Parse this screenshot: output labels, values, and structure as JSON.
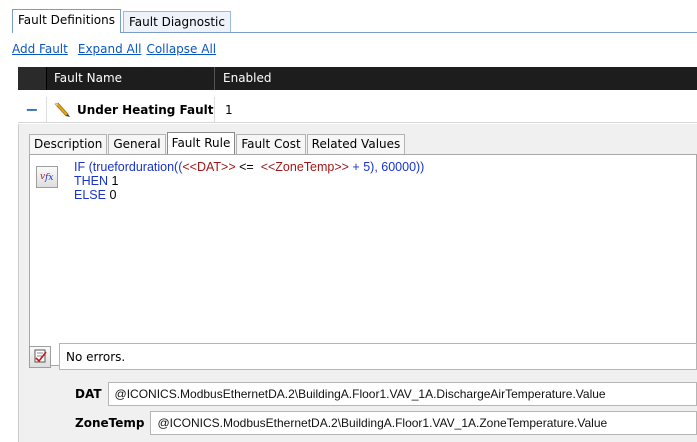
{
  "outer_tabs": [
    {
      "label": "Fault Definitions",
      "active": true
    },
    {
      "label": "Fault Diagnostic",
      "active": false
    }
  ],
  "links": {
    "add_fault": "Add Fault",
    "expand_all": "Expand All",
    "collapse_all": "Collapse All"
  },
  "grid": {
    "columns": {
      "name": "Fault Name",
      "enabled": "Enabled"
    },
    "rows": [
      {
        "toggle": "−",
        "name": "Under Heating Fault",
        "enabled": "1",
        "icon": "pencil-icon"
      }
    ]
  },
  "inner_tabs": [
    {
      "label": "Description",
      "active": false
    },
    {
      "label": "General",
      "active": false
    },
    {
      "label": "Fault Rule",
      "active": true
    },
    {
      "label": "Fault Cost",
      "active": false
    },
    {
      "label": "Related Values",
      "active": false
    }
  ],
  "rule": {
    "line1": {
      "kw_if": "IF",
      "part1": " (trueforduration((",
      "tag1": "<<DAT>>",
      "part2": " <=  ",
      "tag2": "<<ZoneTemp>>",
      "part3": " + 5), 60000))"
    },
    "line2": {
      "kw": "THEN",
      "val": " 1"
    },
    "line3": {
      "kw": "ELSE",
      "val": " 0"
    }
  },
  "status": {
    "message": "No errors."
  },
  "variables": [
    {
      "label": "DAT",
      "value": "@ICONICS.ModbusEthernetDA.2\\BuildingA.Floor1.VAV_1A.DischargeAirTemperature.Value"
    },
    {
      "label": "ZoneTemp",
      "value": "@ICONICS.ModbusEthernetDA.2\\BuildingA.Floor1.VAV_1A.ZoneTemperature.Value"
    }
  ],
  "colors": {
    "keyword": "#1a33cc",
    "tag": "#a01818",
    "link": "#0b57c2",
    "header_bg": "#1d1d1d"
  }
}
